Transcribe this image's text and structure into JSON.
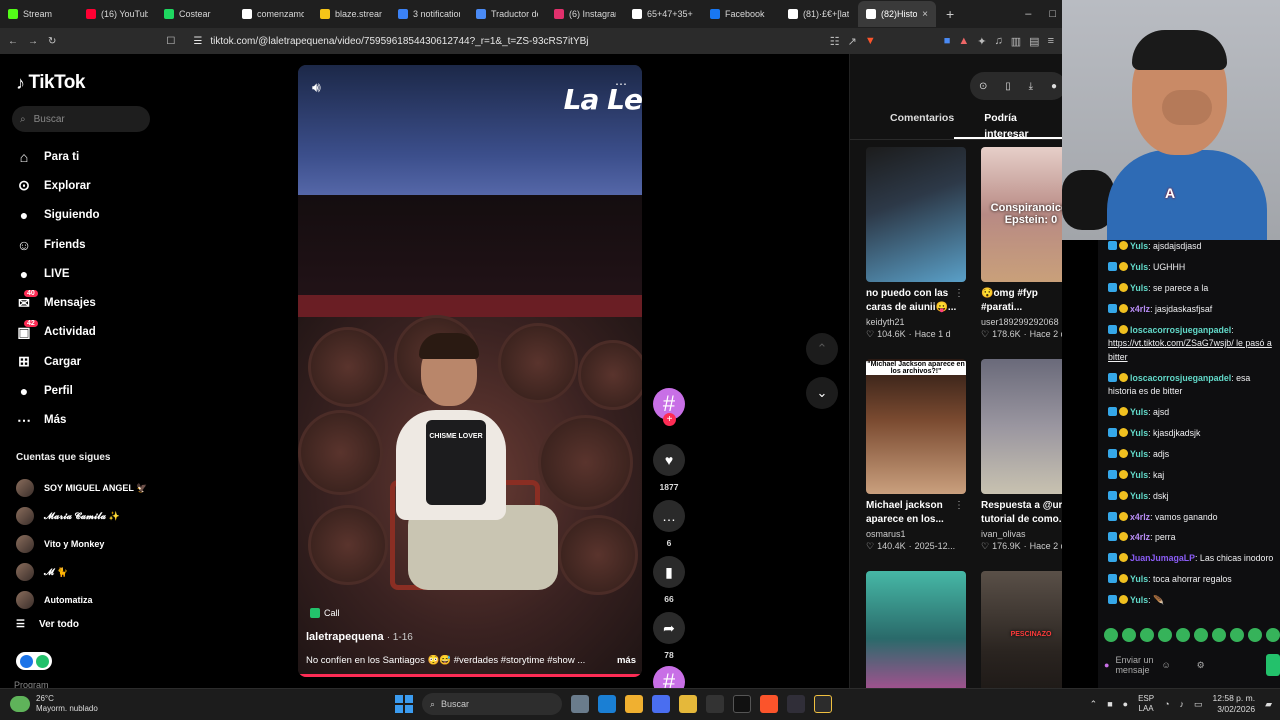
{
  "browser": {
    "tabs": [
      {
        "label": "Stream",
        "color": "#53fc18"
      },
      {
        "label": "(16) YouTube",
        "color": "#ff0033"
      },
      {
        "label": "Costear",
        "color": "#1ed760"
      },
      {
        "label": "comenzamos",
        "color": "#ffffff"
      },
      {
        "label": "blaze.stream",
        "color": "#f5c518"
      },
      {
        "label": "3 notification",
        "color": "#3b82f6"
      },
      {
        "label": "Traductor de",
        "color": "#4a8af4"
      },
      {
        "label": "(6) Instagram",
        "color": "#e1306c"
      },
      {
        "label": "65+47+35+",
        "color": "#ffffff"
      },
      {
        "label": "Facebook",
        "color": "#1877f2"
      },
      {
        "label": "(81)·£€+[lat",
        "color": "#ffffff"
      },
      {
        "label": "(82)Histo",
        "color": "#ffffff",
        "active": true
      }
    ],
    "url": "tiktok.com/@laletrapequena/video/7595961854430612744?_r=1&_t=ZS-93cRS7itYBj"
  },
  "sidebar": {
    "logo": "TikTok",
    "search_placeholder": "Buscar",
    "nav": [
      {
        "label": "Para ti",
        "icon": "home-icon",
        "glyph": "⌂"
      },
      {
        "label": "Explorar",
        "icon": "compass-icon",
        "glyph": "⊙"
      },
      {
        "label": "Siguiendo",
        "icon": "following-avatar-icon",
        "glyph": "●"
      },
      {
        "label": "Friends",
        "icon": "friends-icon",
        "glyph": "☺"
      },
      {
        "label": "LIVE",
        "icon": "live-avatar-icon",
        "glyph": "●"
      },
      {
        "label": "Mensajes",
        "icon": "messages-icon",
        "glyph": "✉",
        "badge": "40"
      },
      {
        "label": "Actividad",
        "icon": "activity-icon",
        "glyph": "▣",
        "badge": "42"
      },
      {
        "label": "Cargar",
        "icon": "upload-icon",
        "glyph": "⊞"
      },
      {
        "label": "Perfil",
        "icon": "profile-icon",
        "glyph": "●"
      },
      {
        "label": "Más",
        "icon": "more-icon",
        "glyph": "⋯"
      }
    ],
    "following_header": "Cuentas que sigues",
    "following": [
      "SOY MIGUEL ANGEL 🦅",
      "𝓜𝓪𝓻𝓲𝓪 𝓒𝓪𝓶𝓲𝓵𝓪 ✨",
      "Vito y Monkey",
      "𝓜 🐈",
      "Automatiza"
    ],
    "see_all": "Ver todo",
    "program": "Program"
  },
  "video": {
    "brand": "La Le",
    "apron_text": "CHISME LOVER",
    "call_label": "Call",
    "author": "laletrapequena",
    "date": "· 1-16",
    "description": "No confíen en los Santiagos 😳😅 #verdades #storytime #show ...",
    "more_label": "más"
  },
  "actions": {
    "likes": "1877",
    "comments": "6",
    "saves": "66",
    "shares": "78"
  },
  "right_panel": {
    "tabs": [
      "Comentarios",
      "Podría interesar"
    ],
    "cards": [
      {
        "title": "no puedo con las caras de aiunii😛...",
        "author": "keidyth21",
        "views": "104.6K",
        "date": "Hace 1 d",
        "overlay": ""
      },
      {
        "title": "😯omg #fyp #parati...",
        "author": "user189299292068",
        "views": "178.6K",
        "date": "Hace 2 d",
        "overlay": "Conspiranoico: Epstein: 0"
      },
      {
        "title": "Michael jackson aparece en los...",
        "author": "osmarus1",
        "views": "140.4K",
        "date": "2025-12...",
        "overlay": "\"Michael Jackson aparece en los archivos?!\""
      },
      {
        "title": "Respuesta a @uri tutorial de como...",
        "author": "ivan_olivas",
        "views": "176.9K",
        "date": "Hace 2 d",
        "overlay": ""
      },
      {
        "title": "",
        "author": "",
        "views": "",
        "date": "",
        "overlay": ""
      },
      {
        "title": "",
        "author": "",
        "views": "",
        "date": "",
        "overlay": "PESCINAZO"
      }
    ]
  },
  "chat": {
    "messages": [
      {
        "user": "Yuls",
        "color": "#62d9c9",
        "text": "ajsdajsdjasd"
      },
      {
        "user": "Yuls",
        "color": "#62d9c9",
        "text": "UGHHH"
      },
      {
        "user": "Yuls",
        "color": "#62d9c9",
        "text": "se parece a la"
      },
      {
        "user": "x4rlz",
        "color": "#b98df6",
        "text": "jasjdaskasfjsaf"
      },
      {
        "user": "loscacorrosjueganpadel",
        "color": "#62d9c9",
        "text": "https://vt.tiktok.com/ZSaG7wsjb/ le pasó a bitter",
        "link": true
      },
      {
        "user": "loscacorrosjueganpadel",
        "color": "#62d9c9",
        "text": "esa historia es de bitter"
      },
      {
        "user": "Yuls",
        "color": "#62d9c9",
        "text": "ajsd"
      },
      {
        "user": "Yuls",
        "color": "#62d9c9",
        "text": "kjasdjkadsjk"
      },
      {
        "user": "Yuls",
        "color": "#62d9c9",
        "text": "adjs"
      },
      {
        "user": "Yuls",
        "color": "#62d9c9",
        "text": "kaj"
      },
      {
        "user": "Yuls",
        "color": "#62d9c9",
        "text": "dskj"
      },
      {
        "user": "x4rlz",
        "color": "#b98df6",
        "text": "vamos ganando"
      },
      {
        "user": "x4rlz",
        "color": "#b98df6",
        "text": "perra"
      },
      {
        "user": "JuanJumagaLP",
        "color": "#8a5cf5",
        "text": "Las chicas inodoro"
      },
      {
        "user": "Yuls",
        "color": "#62d9c9",
        "text": "toca ahorrar regalos"
      },
      {
        "user": "Yuls",
        "color": "#62d9c9",
        "text": "🪶"
      }
    ],
    "input_placeholder": "Enviar un mensaje"
  },
  "taskbar": {
    "temp": "26°C",
    "weather": "Mayorm. nublado",
    "search": "Buscar",
    "lang": "ESP",
    "lang2": "LAA",
    "time": "12:58 p. m.",
    "date": "3/02/2026"
  }
}
